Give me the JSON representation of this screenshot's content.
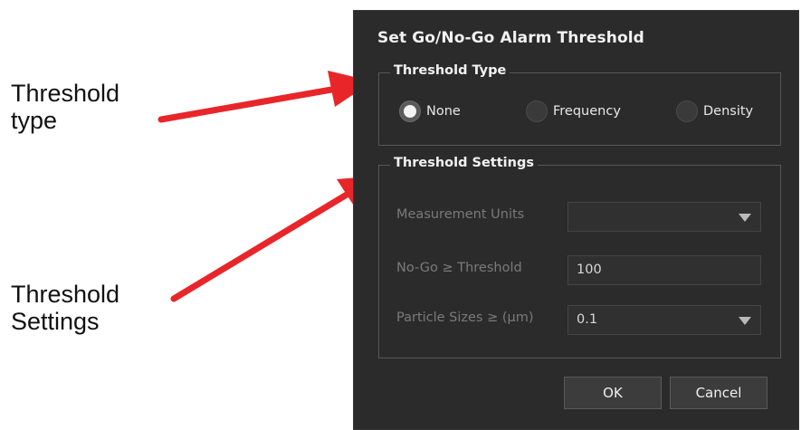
{
  "annotations": {
    "threshold_type_line1": "Threshold",
    "threshold_type_line2": "type",
    "threshold_settings_line1": "Threshold",
    "threshold_settings_line2": "Settings",
    "arrow_color": "#e8262a"
  },
  "dialog": {
    "title": "Set Go/No-Go Alarm Threshold",
    "threshold_type": {
      "legend": "Threshold Type",
      "options": [
        {
          "label": "None",
          "checked": true
        },
        {
          "label": "Frequency",
          "checked": false
        },
        {
          "label": "Density",
          "checked": false
        }
      ]
    },
    "threshold_settings": {
      "legend": "Threshold Settings",
      "measurement_units": {
        "label": "Measurement Units",
        "value": ""
      },
      "no_go_threshold": {
        "label": "No-Go ≥ Threshold",
        "value": "100"
      },
      "particle_sizes": {
        "label": "Particle Sizes ≥ (µm)",
        "value": "0.1"
      }
    },
    "buttons": {
      "ok": "OK",
      "cancel": "Cancel"
    }
  },
  "colors": {
    "dialog_background": "#2b2b2b",
    "disabled_text": "#7a7a7a"
  }
}
